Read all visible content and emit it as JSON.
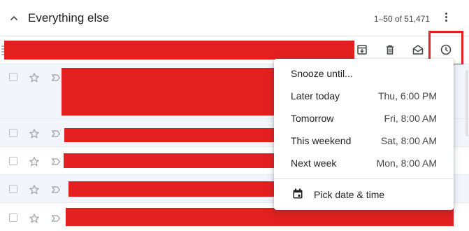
{
  "section": {
    "title": "Everything else",
    "page_range": "1–50 of 51,471"
  },
  "icons": {
    "collapse": "chevron-up-icon",
    "more": "more-vertical-icon",
    "archive": "archive-icon",
    "delete": "trash-icon",
    "mark_read": "envelope-open-icon",
    "snooze": "clock-icon",
    "calendar": "calendar-icon"
  },
  "colors": {
    "redaction": "#e41f1f",
    "highlight_border": "#e41f1f",
    "read_row_bg": "#f2f6fc"
  },
  "snooze_menu": {
    "heading": "Snooze until...",
    "options": [
      {
        "label": "Later today",
        "value": "Thu, 6:00 PM"
      },
      {
        "label": "Tomorrow",
        "value": "Fri, 8:00 AM"
      },
      {
        "label": "This weekend",
        "value": "Sat, 8:00 AM"
      },
      {
        "label": "Next week",
        "value": "Mon, 8:00 AM"
      }
    ],
    "pick_date_label": "Pick date & time"
  }
}
